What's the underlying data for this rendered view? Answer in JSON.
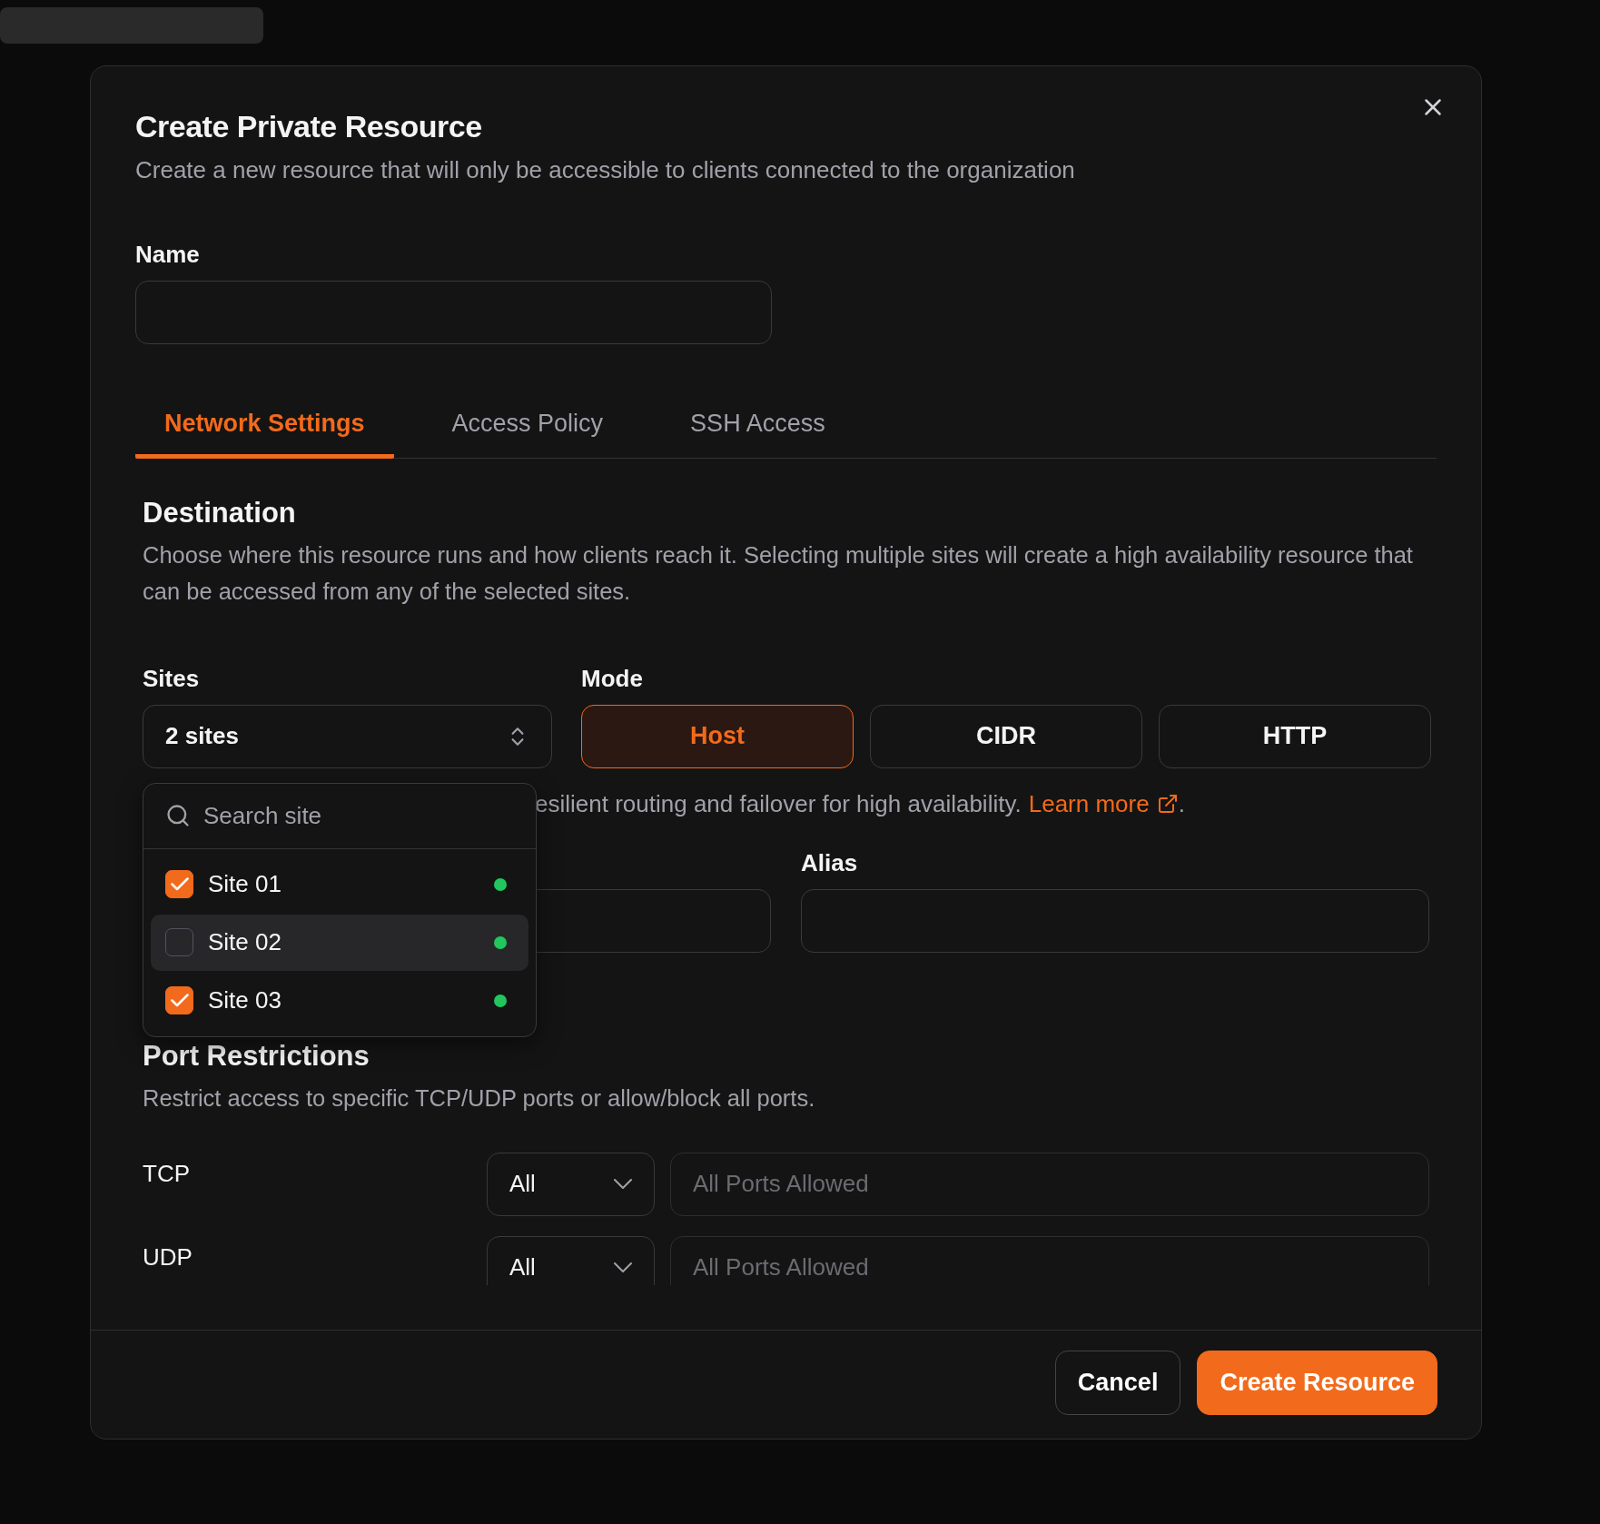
{
  "dialog": {
    "title": "Create Private Resource",
    "subtitle": "Create a new resource that will only be accessible to clients connected to the organization"
  },
  "name_field": {
    "label": "Name"
  },
  "tabs": [
    {
      "label": "Network Settings",
      "selected": true
    },
    {
      "label": "Access Policy",
      "selected": false
    },
    {
      "label": "SSH Access",
      "selected": false
    }
  ],
  "destination": {
    "heading": "Destination",
    "description": "Choose where this resource runs and how clients reach it. Selecting multiple sites will create a high availability resource that can be accessed from any of the selected sites."
  },
  "sites": {
    "label": "Sites",
    "value": "2 sites"
  },
  "mode": {
    "label": "Mode",
    "options": [
      {
        "label": "Host",
        "selected": true
      },
      {
        "label": "CIDR",
        "selected": false
      },
      {
        "label": "HTTP",
        "selected": false
      }
    ]
  },
  "hint": {
    "text": "esilient routing and failover for high availability.",
    "link": "Learn more",
    "after": "."
  },
  "alias_field": {
    "label": "Alias"
  },
  "site_dropdown": {
    "search_placeholder": "Search site",
    "items": [
      {
        "label": "Site 01",
        "checked": true,
        "highlighted": false,
        "color": "#22c55e"
      },
      {
        "label": "Site 02",
        "checked": false,
        "highlighted": true,
        "color": "#22c55e"
      },
      {
        "label": "Site 03",
        "checked": true,
        "highlighted": false,
        "color": "#22c55e"
      }
    ]
  },
  "port_restrictions": {
    "heading": "Port Restrictions",
    "description": "Restrict access to specific TCP/UDP ports or allow/block all ports.",
    "rows": [
      {
        "protocol": "TCP",
        "mode": "All",
        "placeholder": "All Ports Allowed"
      },
      {
        "protocol": "UDP",
        "mode": "All",
        "placeholder": "All Ports Allowed"
      }
    ]
  },
  "footer": {
    "buttons": [
      {
        "label": "Cancel",
        "kind": "secondary"
      },
      {
        "label": "Create Resource",
        "kind": "primary"
      }
    ]
  }
}
